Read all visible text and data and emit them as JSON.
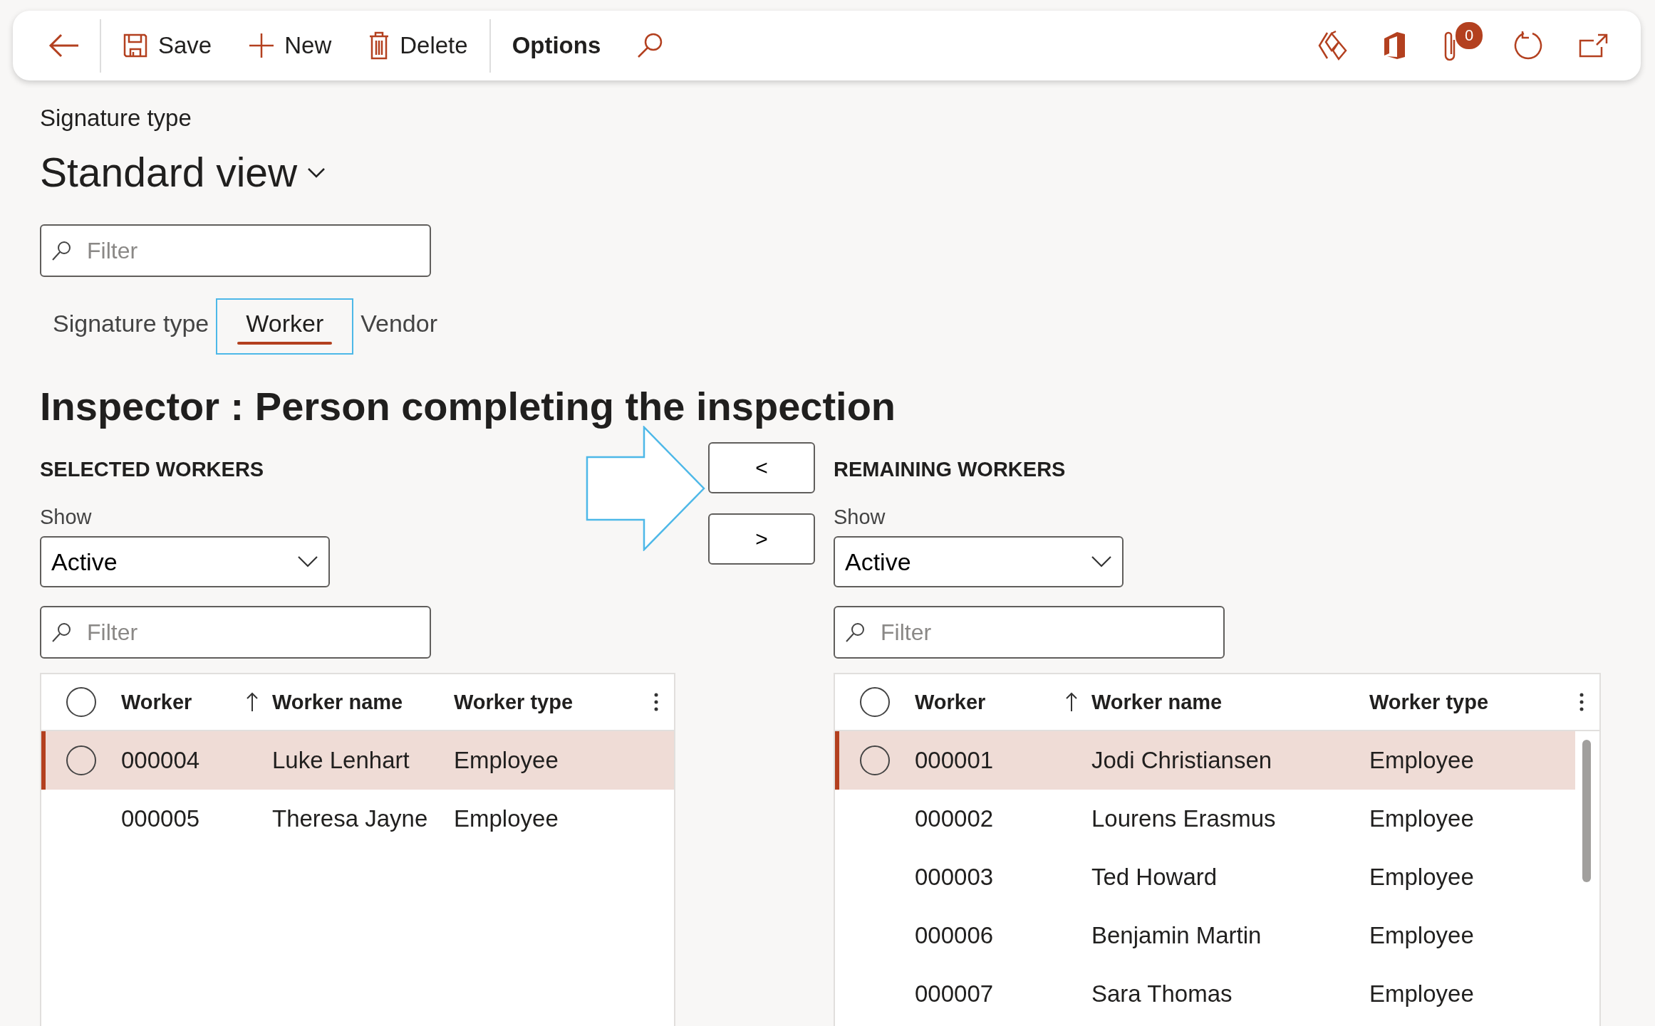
{
  "toolbar": {
    "actions": [
      {
        "kind": "save",
        "label": "Save"
      },
      {
        "kind": "new",
        "label": "New"
      },
      {
        "kind": "delete",
        "label": "Delete"
      }
    ],
    "options": "Options",
    "attachments_badge": "0"
  },
  "page": {
    "caption": "Signature type",
    "view": "Standard view",
    "filter_placeholder": "Filter"
  },
  "tabs": [
    {
      "label": "Signature type",
      "selected": false
    },
    {
      "label": "Worker",
      "selected": true
    },
    {
      "label": "Vendor",
      "selected": false
    }
  ],
  "heading": "Inspector : Person completing the inspection",
  "move_buttons": [
    "<",
    ">"
  ],
  "panels": [
    {
      "title": "SELECTED WORKERS",
      "all_selected": false,
      "show_label": "Show",
      "show_value": "Active",
      "filter_placeholder": "Filter",
      "columns": [
        "Worker",
        "Worker name",
        "Worker type"
      ],
      "rows": [
        {
          "worker": "000004",
          "name": "Luke Lenhart",
          "type": "Employee",
          "selected": true
        },
        {
          "worker": "000005",
          "name": "Theresa Jayne",
          "type": "Employee",
          "selected": false
        }
      ]
    },
    {
      "title": "REMAINING WORKERS",
      "all_selected": false,
      "show_label": "Show",
      "show_value": "Active",
      "filter_placeholder": "Filter",
      "columns": [
        "Worker",
        "Worker name",
        "Worker type"
      ],
      "rows": [
        {
          "worker": "000001",
          "name": "Jodi Christiansen",
          "type": "Employee",
          "selected": true
        },
        {
          "worker": "000002",
          "name": "Lourens Erasmus",
          "type": "Employee",
          "selected": false
        },
        {
          "worker": "000003",
          "name": "Ted Howard",
          "type": "Employee",
          "selected": false
        },
        {
          "worker": "000006",
          "name": "Benjamin Martin",
          "type": "Employee",
          "selected": false
        },
        {
          "worker": "000007",
          "name": "Sara Thomas",
          "type": "Employee",
          "selected": false
        }
      ]
    }
  ]
}
